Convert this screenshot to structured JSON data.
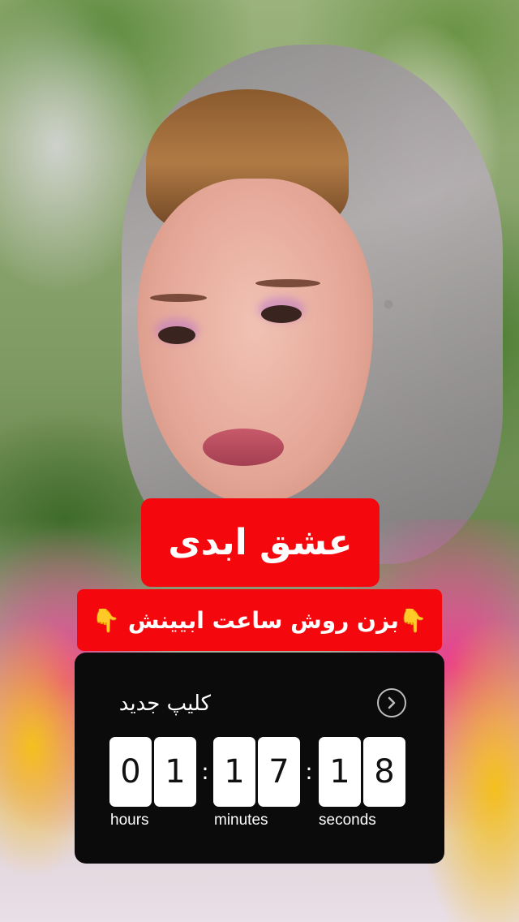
{
  "video": {
    "title_text": "عشق ابدی",
    "subtitle_text": "👇 بزن روش ساعت ابیینش👇"
  },
  "countdown": {
    "title": "کلیپ جدید",
    "digits": [
      "0",
      "1",
      "1",
      "7",
      "1",
      "8"
    ],
    "separator": ":",
    "units": {
      "hours": "hours",
      "minutes": "minutes",
      "seconds": "seconds"
    },
    "icon": "chevron-right-circle-icon"
  },
  "colors": {
    "label_red": "#f4080d",
    "countdown_bg": "#0b0b0b",
    "digit_bg": "#ffffff"
  }
}
